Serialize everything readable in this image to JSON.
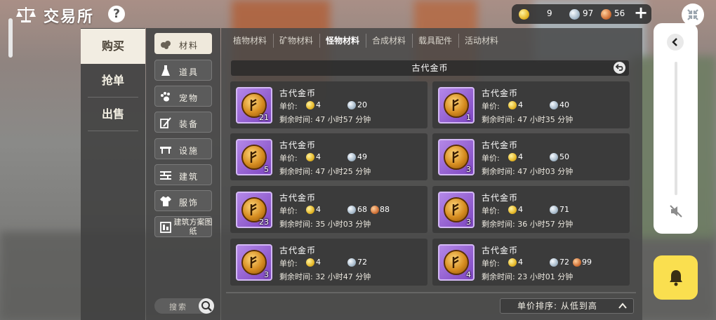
{
  "header": {
    "title": "交易所",
    "help_label": "?"
  },
  "currency": {
    "gold": "9",
    "silver": "97",
    "copper": "56",
    "add_label": "+"
  },
  "main_tabs": [
    {
      "label": "购买",
      "active": true
    },
    {
      "label": "抢单",
      "active": false
    },
    {
      "label": "出售",
      "active": false
    }
  ],
  "sub_categories": [
    {
      "label": "材料",
      "icon": "materials-icon",
      "active": true
    },
    {
      "label": "道具",
      "icon": "potion-icon",
      "active": false
    },
    {
      "label": "宠物",
      "icon": "paw-icon",
      "active": false
    },
    {
      "label": "装备",
      "icon": "equipment-icon",
      "active": false
    },
    {
      "label": "设施",
      "icon": "facility-icon",
      "active": false
    },
    {
      "label": "建筑",
      "icon": "building-icon",
      "active": false
    },
    {
      "label": "服饰",
      "icon": "clothing-icon",
      "active": false
    },
    {
      "label": "建筑方案图纸",
      "icon": "blueprint-icon",
      "active": false
    }
  ],
  "search": {
    "placeholder": "搜索"
  },
  "category_tabs": [
    {
      "label": "植物材料",
      "active": false
    },
    {
      "label": "矿物材料",
      "active": false
    },
    {
      "label": "怪物材料",
      "active": true
    },
    {
      "label": "合成材料",
      "active": false
    },
    {
      "label": "载具配件",
      "active": false
    },
    {
      "label": "活动材料",
      "active": false
    }
  ],
  "item_header": {
    "title": "古代金币"
  },
  "listings": [
    {
      "name": "古代金币",
      "qty": "21",
      "price_label": "单价:",
      "gold": "4",
      "silver": "20",
      "copper": "",
      "time": "剩余时间: 47 小时57 分钟"
    },
    {
      "name": "古代金币",
      "qty": "1",
      "price_label": "单价:",
      "gold": "4",
      "silver": "40",
      "copper": "",
      "time": "剩余时间: 47 小时35 分钟"
    },
    {
      "name": "古代金币",
      "qty": "5",
      "price_label": "单价:",
      "gold": "4",
      "silver": "49",
      "copper": "",
      "time": "剩余时间: 47 小时25 分钟"
    },
    {
      "name": "古代金币",
      "qty": "3",
      "price_label": "单价:",
      "gold": "4",
      "silver": "50",
      "copper": "",
      "time": "剩余时间: 47 小时03 分钟"
    },
    {
      "name": "古代金币",
      "qty": "23",
      "price_label": "单价:",
      "gold": "4",
      "silver": "68",
      "copper": "88",
      "time": "剩余时间: 35 小时03 分钟"
    },
    {
      "name": "古代金币",
      "qty": "3",
      "price_label": "单价:",
      "gold": "4",
      "silver": "71",
      "copper": "",
      "time": "剩余时间: 36 小时57 分钟"
    },
    {
      "name": "古代金币",
      "qty": "3",
      "price_label": "单价:",
      "gold": "4",
      "silver": "72",
      "copper": "",
      "time": "剩余时间: 32 小时47 分钟"
    },
    {
      "name": "古代金币",
      "qty": "4",
      "price_label": "单价:",
      "gold": "4",
      "silver": "72",
      "copper": "99",
      "time": "剩余时间: 23 小时01 分钟"
    }
  ],
  "sort": {
    "label": "单价排序: 从低到高"
  },
  "colors": {
    "active_tab_bg": "#f2ede2",
    "notify_button": "#fadf4f",
    "item_frame": "#9b63d8"
  }
}
